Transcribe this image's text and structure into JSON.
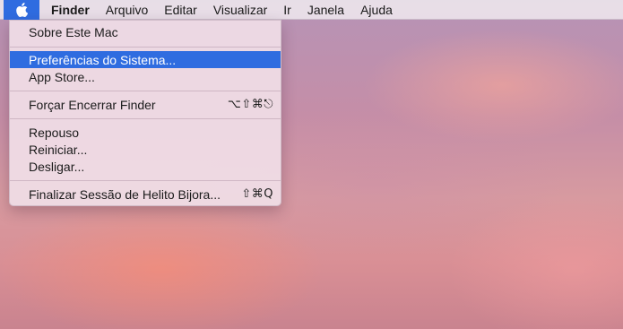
{
  "menubar": {
    "apple_icon": "apple-logo-icon",
    "app_name": "Finder",
    "items": [
      "Arquivo",
      "Editar",
      "Visualizar",
      "Ir",
      "Janela",
      "Ajuda"
    ]
  },
  "apple_menu": {
    "items": [
      {
        "label": "Sobre Este Mac",
        "shortcut": ""
      },
      {
        "label": "Preferências do Sistema...",
        "shortcut": "",
        "highlighted": true
      },
      {
        "label": "App Store...",
        "shortcut": ""
      },
      {
        "label": "Forçar Encerrar Finder",
        "shortcut": "⌥⇧⌘⎋"
      },
      {
        "label": "Repouso",
        "shortcut": ""
      },
      {
        "label": "Reiniciar...",
        "shortcut": ""
      },
      {
        "label": "Desligar...",
        "shortcut": ""
      },
      {
        "label": "Finalizar Sessão de Helito Bijora...",
        "shortcut": "⇧⌘Q"
      }
    ]
  },
  "colors": {
    "highlight": "#2f6ce0",
    "menubar_bg": "#ece4ec"
  }
}
